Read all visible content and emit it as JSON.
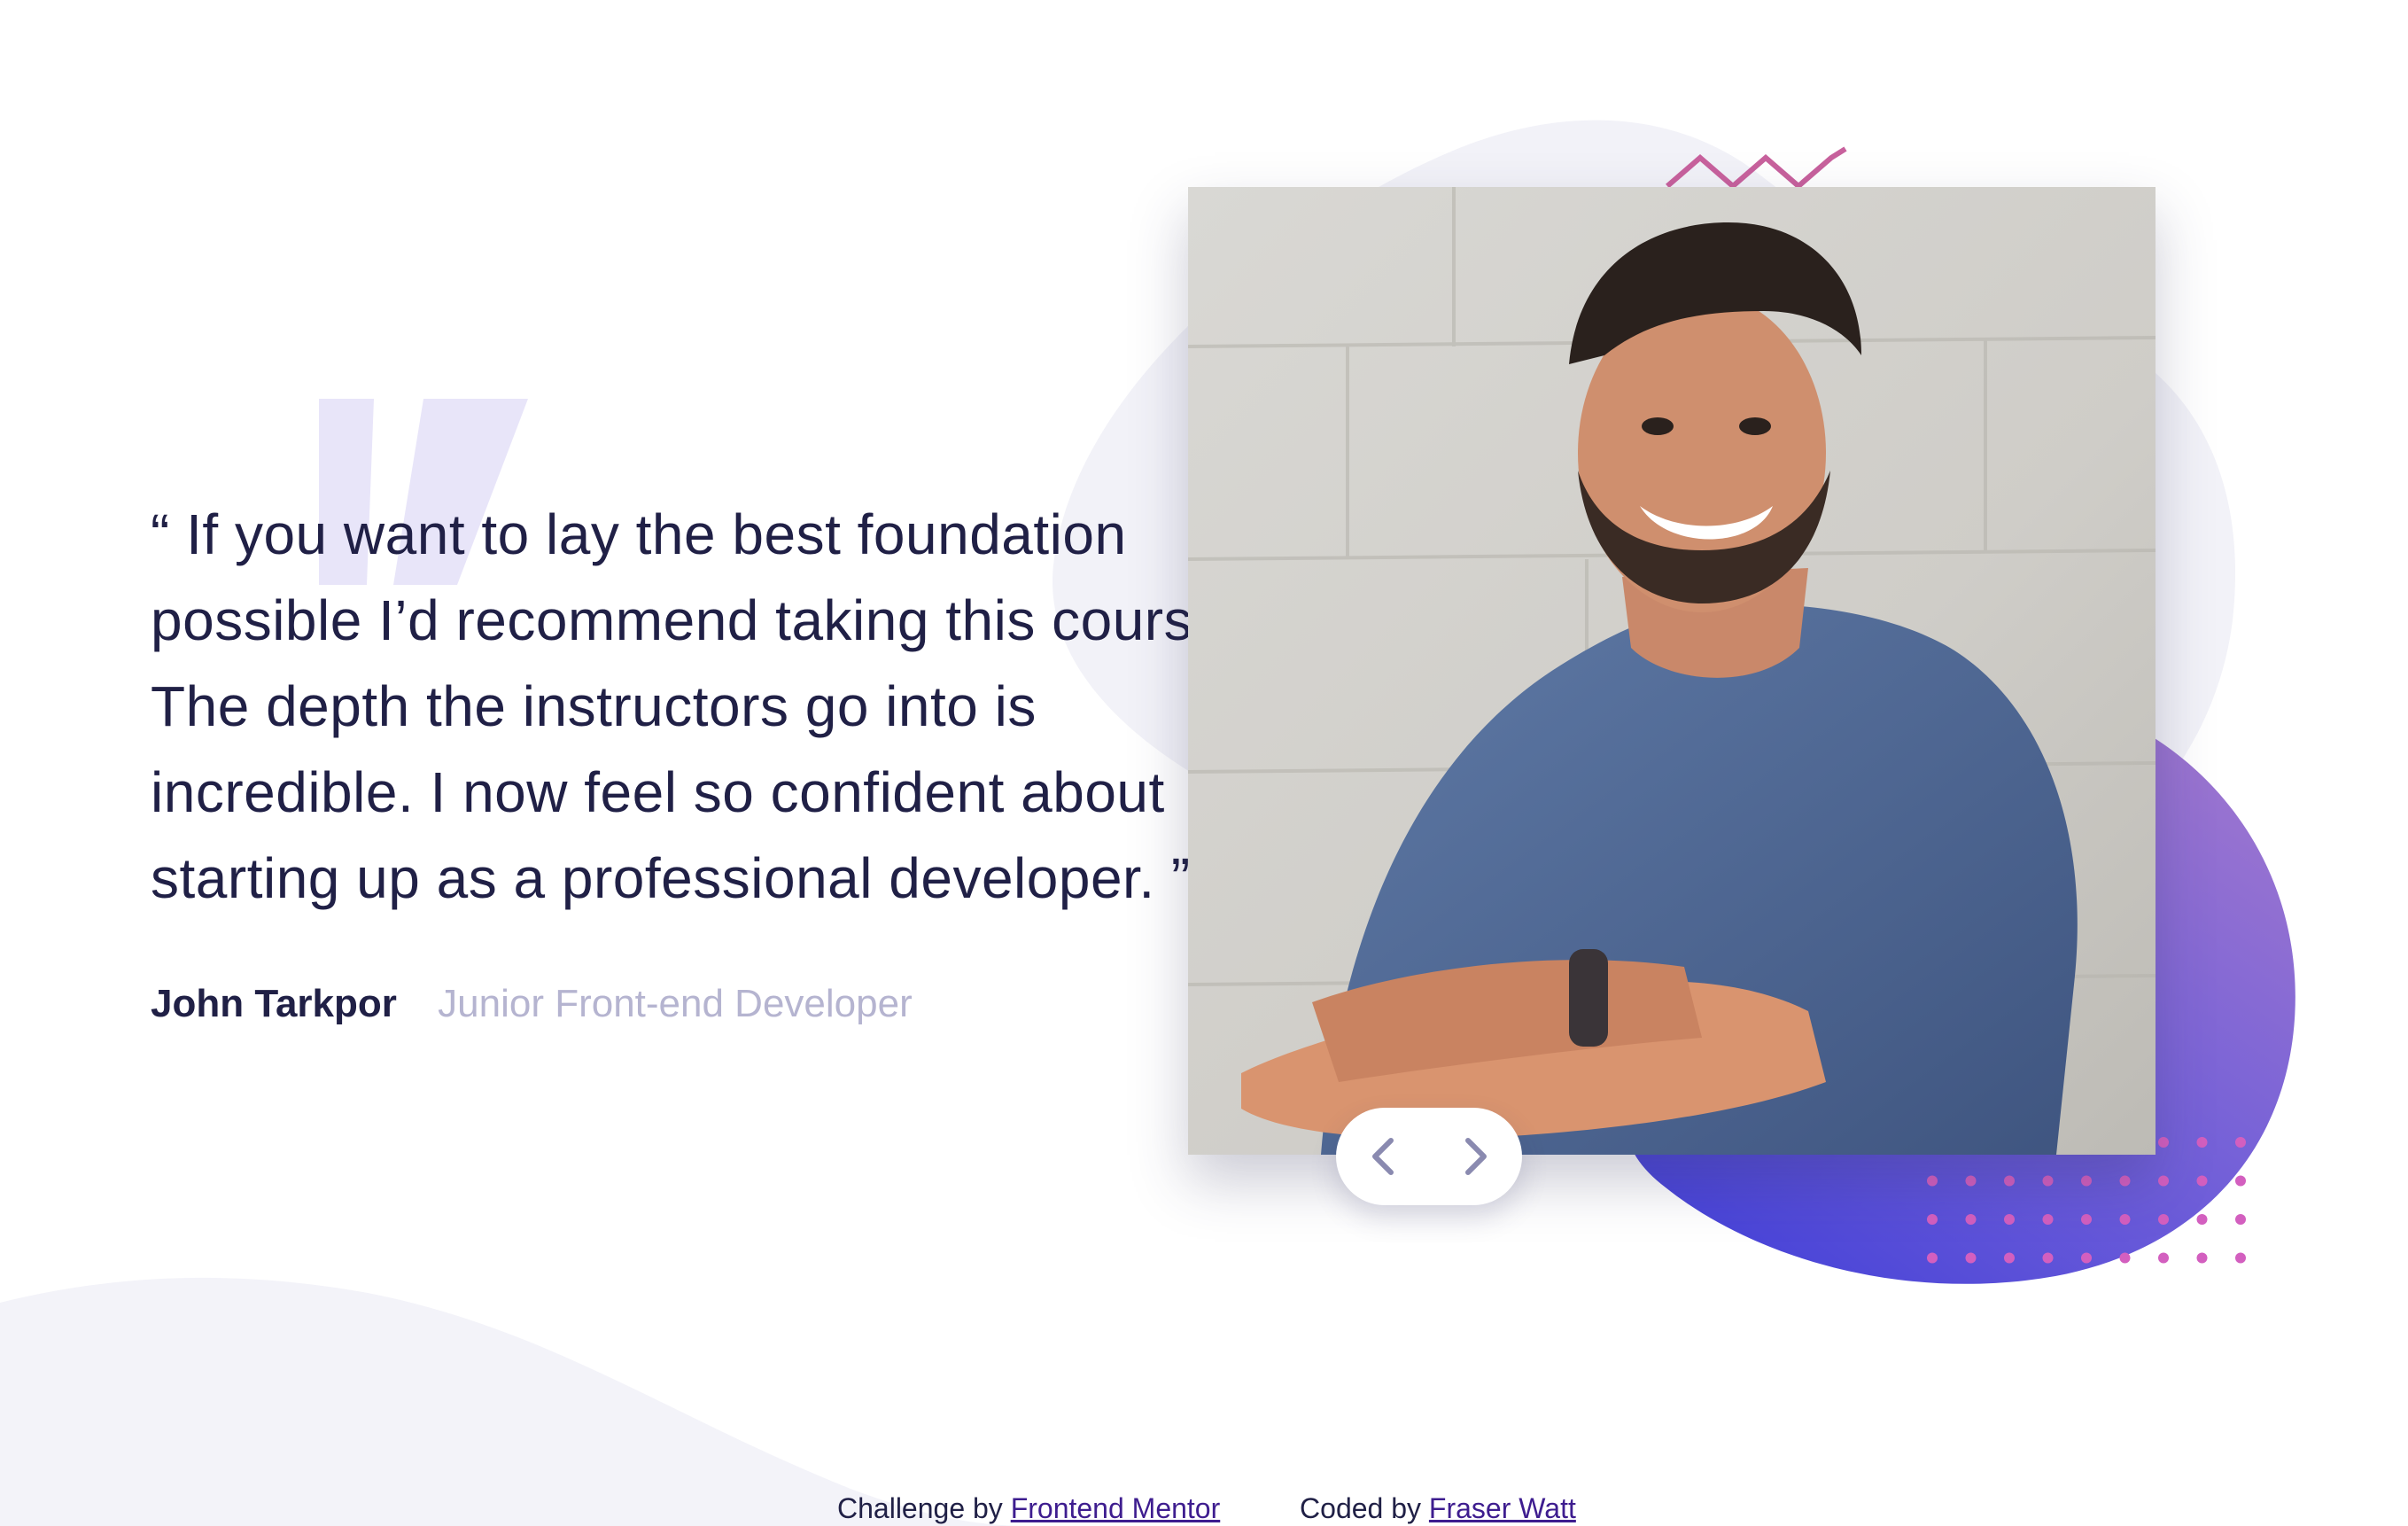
{
  "testimonial": {
    "quote_lines": [
      "“ If you want to lay the best foundation",
      "possible I’d recommend taking this course.",
      "The depth the instructors go into is",
      "incredible. I now feel so confident about",
      "starting up as a professional developer. ”"
    ],
    "author_name": "John Tarkpor",
    "author_role": "Junior Front-end Developer"
  },
  "photo": {
    "alt": "John Tarkpor"
  },
  "navigation": {
    "prev_icon": "chevron-left-icon",
    "next_icon": "chevron-right-icon"
  },
  "attribution": {
    "challenge_prefix": "Challenge by",
    "challenge_link": "Frontend Mentor",
    "coded_prefix": "Coded by",
    "coded_link": "Fraser Watt"
  },
  "colors": {
    "text_dark": "#202046",
    "text_muted": "#b5b4d0",
    "accent_purple": "#6b5ed6",
    "blob_light": "#f2f2f8",
    "link": "#3e1d8f",
    "dots": "#d35fbf",
    "zigzag": "#c8619d"
  }
}
